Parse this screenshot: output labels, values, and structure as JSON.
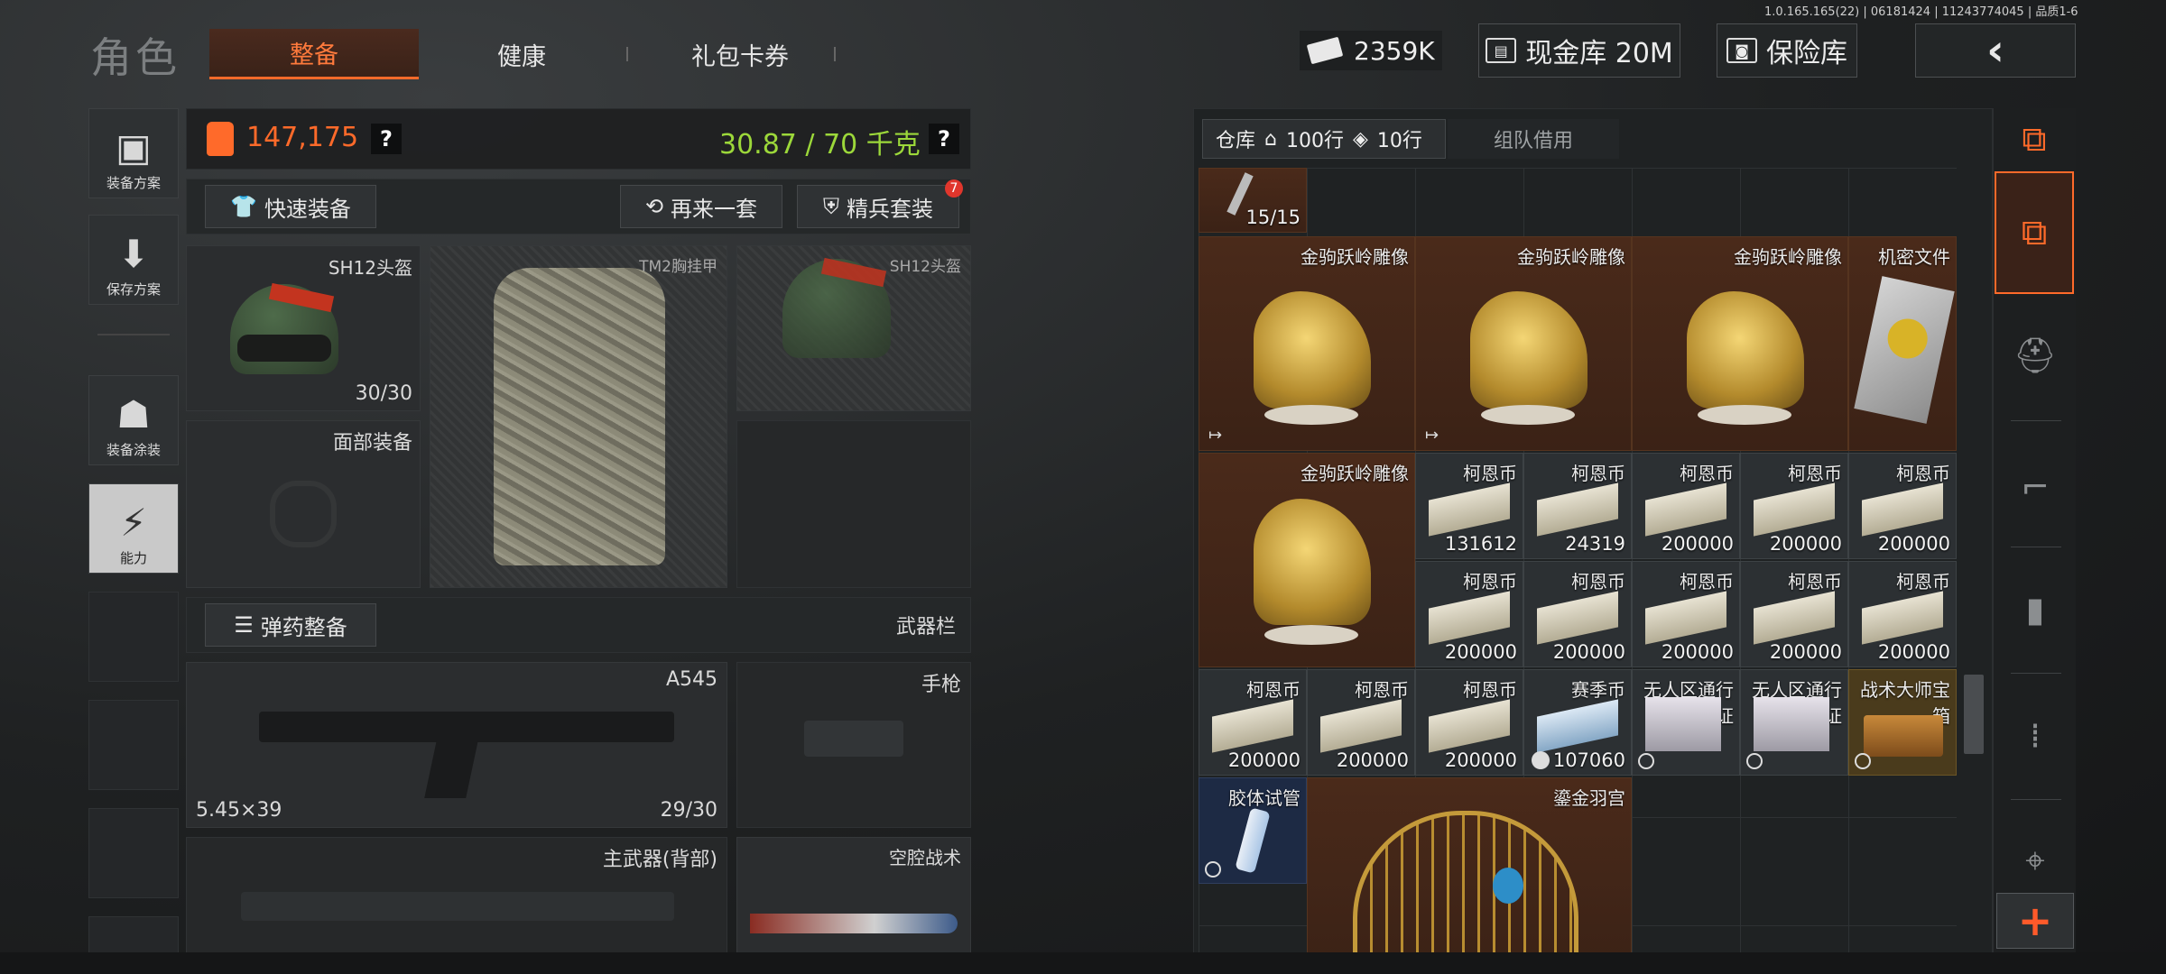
{
  "version": "1.0.165.165(22) | 06181424 | 11243774045 | 品质1-6",
  "header": {
    "title": "角色",
    "tabs": [
      {
        "label": "整备",
        "active": true
      },
      {
        "label": "健康",
        "active": false
      },
      {
        "label": "礼包卡券",
        "active": false
      }
    ],
    "currency": "2359K",
    "cash_vault": "现金库 20M",
    "safe": "保险库",
    "back_icon": "chevron-left-icon"
  },
  "left_nav": [
    {
      "label": "装备方案",
      "icon": "vest-icon"
    },
    {
      "label": "保存方案",
      "icon": "download-icon"
    },
    {
      "label": "装备涂装",
      "icon": "paint-icon"
    },
    {
      "label": "能力",
      "icon": "lightning-icon",
      "active": true
    }
  ],
  "loadout": {
    "value": "147,175",
    "weight": "30.87 / 70 千克",
    "value_color": "#ff6a2a",
    "weight_color": "#9cd83a",
    "quick_equip": "快速装备",
    "again": "再来一套",
    "elite_set": "精兵套装",
    "elite_badge": "7",
    "helmet": {
      "name": "SH12头盔",
      "durability": "30/30"
    },
    "armor": {
      "name": "TM2胸挂甲"
    },
    "helmet_preview": {
      "name": "SH12头盔"
    },
    "face": {
      "name": "面部装备"
    },
    "ammo_btn": "弹药整备",
    "weapon_bar": "武器栏",
    "primary": {
      "name": "A545",
      "caliber": "5.45×39",
      "ammo": "29/30"
    },
    "pistol": {
      "name": "手枪"
    },
    "backup": {
      "name": "主武器(背部)"
    },
    "melee": {
      "name": "空腔战术"
    }
  },
  "stash": {
    "tab_label": "仓库",
    "rows": "100行",
    "cols": "10行",
    "team_tab": "组队借用",
    "items": {
      "top_item_count": "15/15",
      "horse": "金驹跃岭雕像",
      "secret_file": "机密文件",
      "coin": "柯恩币",
      "coin_counts": [
        "131612",
        "24319",
        "200000",
        "200000",
        "200000",
        "200000",
        "200000",
        "200000",
        "200000",
        "200000",
        "200000",
        "200000",
        "200000"
      ],
      "season_coin": "赛季币",
      "season_count": "107060",
      "pass": "无人区通行证",
      "chest": "战术大师宝箱",
      "tube": "胶体试管",
      "cage": "鎏金羽宫"
    }
  },
  "rail": {
    "icons": [
      "layers-refresh-icon",
      "layers-icon",
      "helmet-icon",
      "rifle-icon",
      "magazine-icon",
      "bullet-icon",
      "sight-icon",
      "plus-icon"
    ]
  }
}
